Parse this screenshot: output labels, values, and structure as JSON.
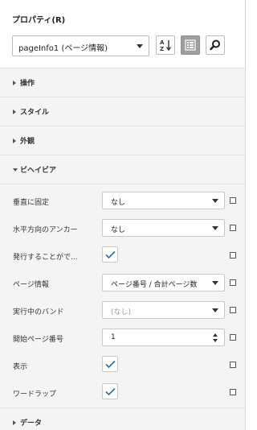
{
  "panel": {
    "title": "プロパティ(R)",
    "object_select": {
      "value": "pageInfo1 (ページ情報)"
    },
    "toolbar": {
      "sort_icon": "sort-alpha-icon",
      "categorized_icon": "categorized-view-icon",
      "search_icon": "search-icon"
    }
  },
  "sections": {
    "operation": "操作",
    "style": "スタイル",
    "appearance": "外観",
    "behavior": "ビヘイビア",
    "data": "データ"
  },
  "properties": [
    {
      "name": "垂直に固定",
      "type": "dropdown",
      "value": "なし"
    },
    {
      "name": "水平方向のアンカー",
      "type": "dropdown",
      "value": "なし"
    },
    {
      "name": "発行することがで...",
      "type": "checkbox",
      "checked": true
    },
    {
      "name": "ページ情報",
      "type": "dropdown",
      "value": "ページ番号 / 合計ページ数"
    },
    {
      "name": "実行中のバンド",
      "type": "dropdown",
      "value": "(なし)",
      "disabled": true
    },
    {
      "name": "開始ページ番号",
      "type": "spinner",
      "value": "1"
    },
    {
      "name": "表示",
      "type": "checkbox",
      "checked": true
    },
    {
      "name": "ワードラップ",
      "type": "checkbox",
      "checked": true
    }
  ],
  "colors": {
    "check": "#2d6c9c",
    "panel_bg": "#f4f4f4",
    "active_toggle": "#9e9e9e"
  }
}
